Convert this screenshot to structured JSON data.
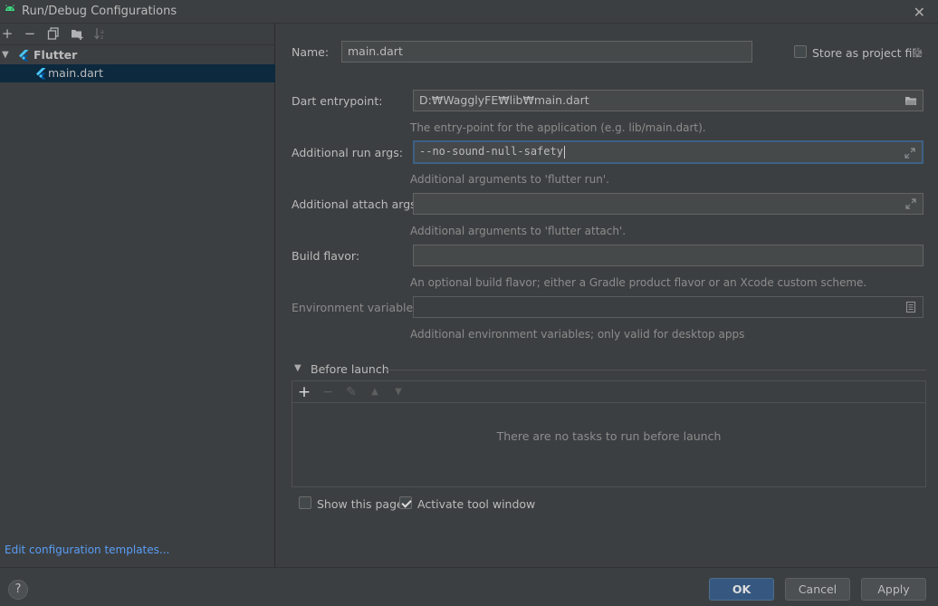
{
  "window": {
    "title": "Run/Debug Configurations",
    "close_glyph": "✕",
    "app_icon": "android-icon"
  },
  "toolbar": {
    "add": "+",
    "remove": "−",
    "icons": [
      "add-icon",
      "remove-icon",
      "copy-icon",
      "new-folder-icon",
      "sort-icon"
    ]
  },
  "tree": {
    "group_label": "Flutter",
    "item_label": "main.dart"
  },
  "edit_templates_link": "Edit configuration templates...",
  "form": {
    "name_label": "Name:",
    "name_value": "main.dart",
    "store_label": "Store as project file",
    "store_checked": false,
    "entrypoint_label": "Dart entrypoint:",
    "entrypoint_value": "D:₩WagglyFE₩lib₩main.dart",
    "entrypoint_hint": "The entry-point for the application (e.g. lib/main.dart).",
    "run_args_label": "Additional run args:",
    "run_args_value": "--no-sound-null-safety",
    "run_args_hint": "Additional arguments to 'flutter run'.",
    "attach_args_label": "Additional attach args:",
    "attach_args_value": "",
    "attach_args_hint": "Additional arguments to 'flutter attach'.",
    "build_flavor_label": "Build flavor:",
    "build_flavor_value": "",
    "build_flavor_hint": "An optional build flavor; either a Gradle product flavor or an Xcode custom scheme.",
    "env_label": "Environment variables:",
    "env_value": "",
    "env_hint": "Additional environment variables; only valid for desktop apps"
  },
  "before_launch": {
    "title": "Before launch",
    "toolbar": {
      "add": "+",
      "remove": "−",
      "edit": "✎",
      "up": "▲",
      "down": "▼"
    },
    "empty_text": "There are no tasks to run before launch"
  },
  "options": {
    "show_page_label": "Show this page",
    "show_page_checked": false,
    "activate_tool_label": "Activate tool window",
    "activate_tool_checked": true
  },
  "buttons": {
    "help": "?",
    "ok": "OK",
    "cancel": "Cancel",
    "apply": "Apply"
  },
  "colors": {
    "background": "#3c3f41",
    "selection": "#0d293e",
    "link": "#589df6",
    "primary_button": "#365880",
    "focus_border": "#3d6185",
    "flutter_blue": "#47c5fb"
  }
}
